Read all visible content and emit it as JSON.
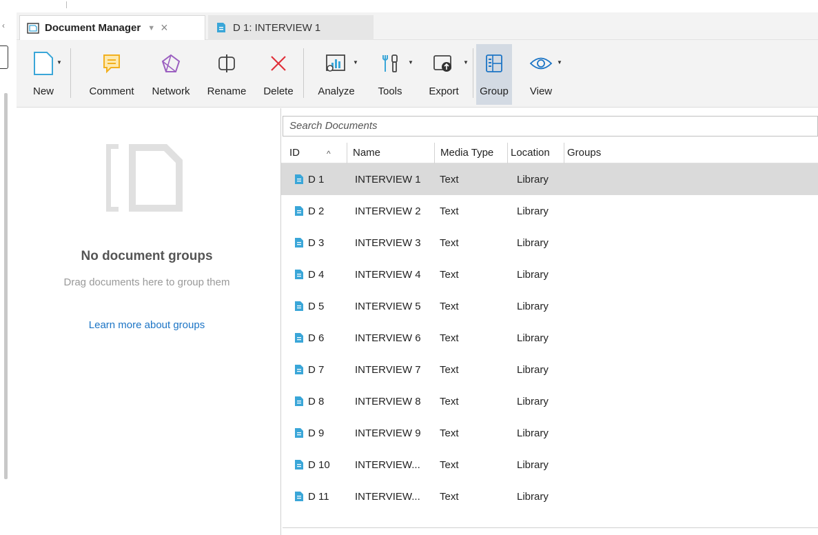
{
  "tabs": [
    {
      "label": "Document Manager",
      "active": true
    },
    {
      "label": "D 1: INTERVIEW 1",
      "active": false
    }
  ],
  "toolbar": {
    "new": "New",
    "comment": "Comment",
    "network": "Network",
    "rename": "Rename",
    "delete": "Delete",
    "analyze": "Analyze",
    "tools": "Tools",
    "export": "Export",
    "group": "Group",
    "view": "View"
  },
  "groups_panel": {
    "empty_title": "No document groups",
    "hint": "Drag documents here to group them",
    "learn_link": "Learn more about groups"
  },
  "search": {
    "placeholder": "Search Documents"
  },
  "columns": {
    "id": "ID",
    "name": "Name",
    "media_type": "Media Type",
    "location": "Location",
    "groups": "Groups"
  },
  "documents": [
    {
      "id": "D 1",
      "name": "INTERVIEW 1",
      "type": "Text",
      "location": "Library"
    },
    {
      "id": "D 2",
      "name": "INTERVIEW 2",
      "type": "Text",
      "location": "Library"
    },
    {
      "id": "D 3",
      "name": "INTERVIEW 3",
      "type": "Text",
      "location": "Library"
    },
    {
      "id": "D 4",
      "name": "INTERVIEW 4",
      "type": "Text",
      "location": "Library"
    },
    {
      "id": "D 5",
      "name": "INTERVIEW 5",
      "type": "Text",
      "location": "Library"
    },
    {
      "id": "D 6",
      "name": "INTERVIEW 6",
      "type": "Text",
      "location": "Library"
    },
    {
      "id": "D 7",
      "name": "INTERVIEW 7",
      "type": "Text",
      "location": "Library"
    },
    {
      "id": "D 8",
      "name": "INTERVIEW 8",
      "type": "Text",
      "location": "Library"
    },
    {
      "id": "D 9",
      "name": "INTERVIEW 9",
      "type": "Text",
      "location": "Library"
    },
    {
      "id": "D 10",
      "name": "INTERVIEW...",
      "type": "Text",
      "location": "Library"
    },
    {
      "id": "D 11",
      "name": "INTERVIEW...",
      "type": "Text",
      "location": "Library"
    }
  ],
  "colors": {
    "accent": "#1b74c5",
    "doc_icon": "#3aa6d8",
    "comment_icon": "#f2b01e",
    "network_icon": "#9b5fc0",
    "delete_icon": "#e0303a",
    "selected_row": "#dadada"
  }
}
